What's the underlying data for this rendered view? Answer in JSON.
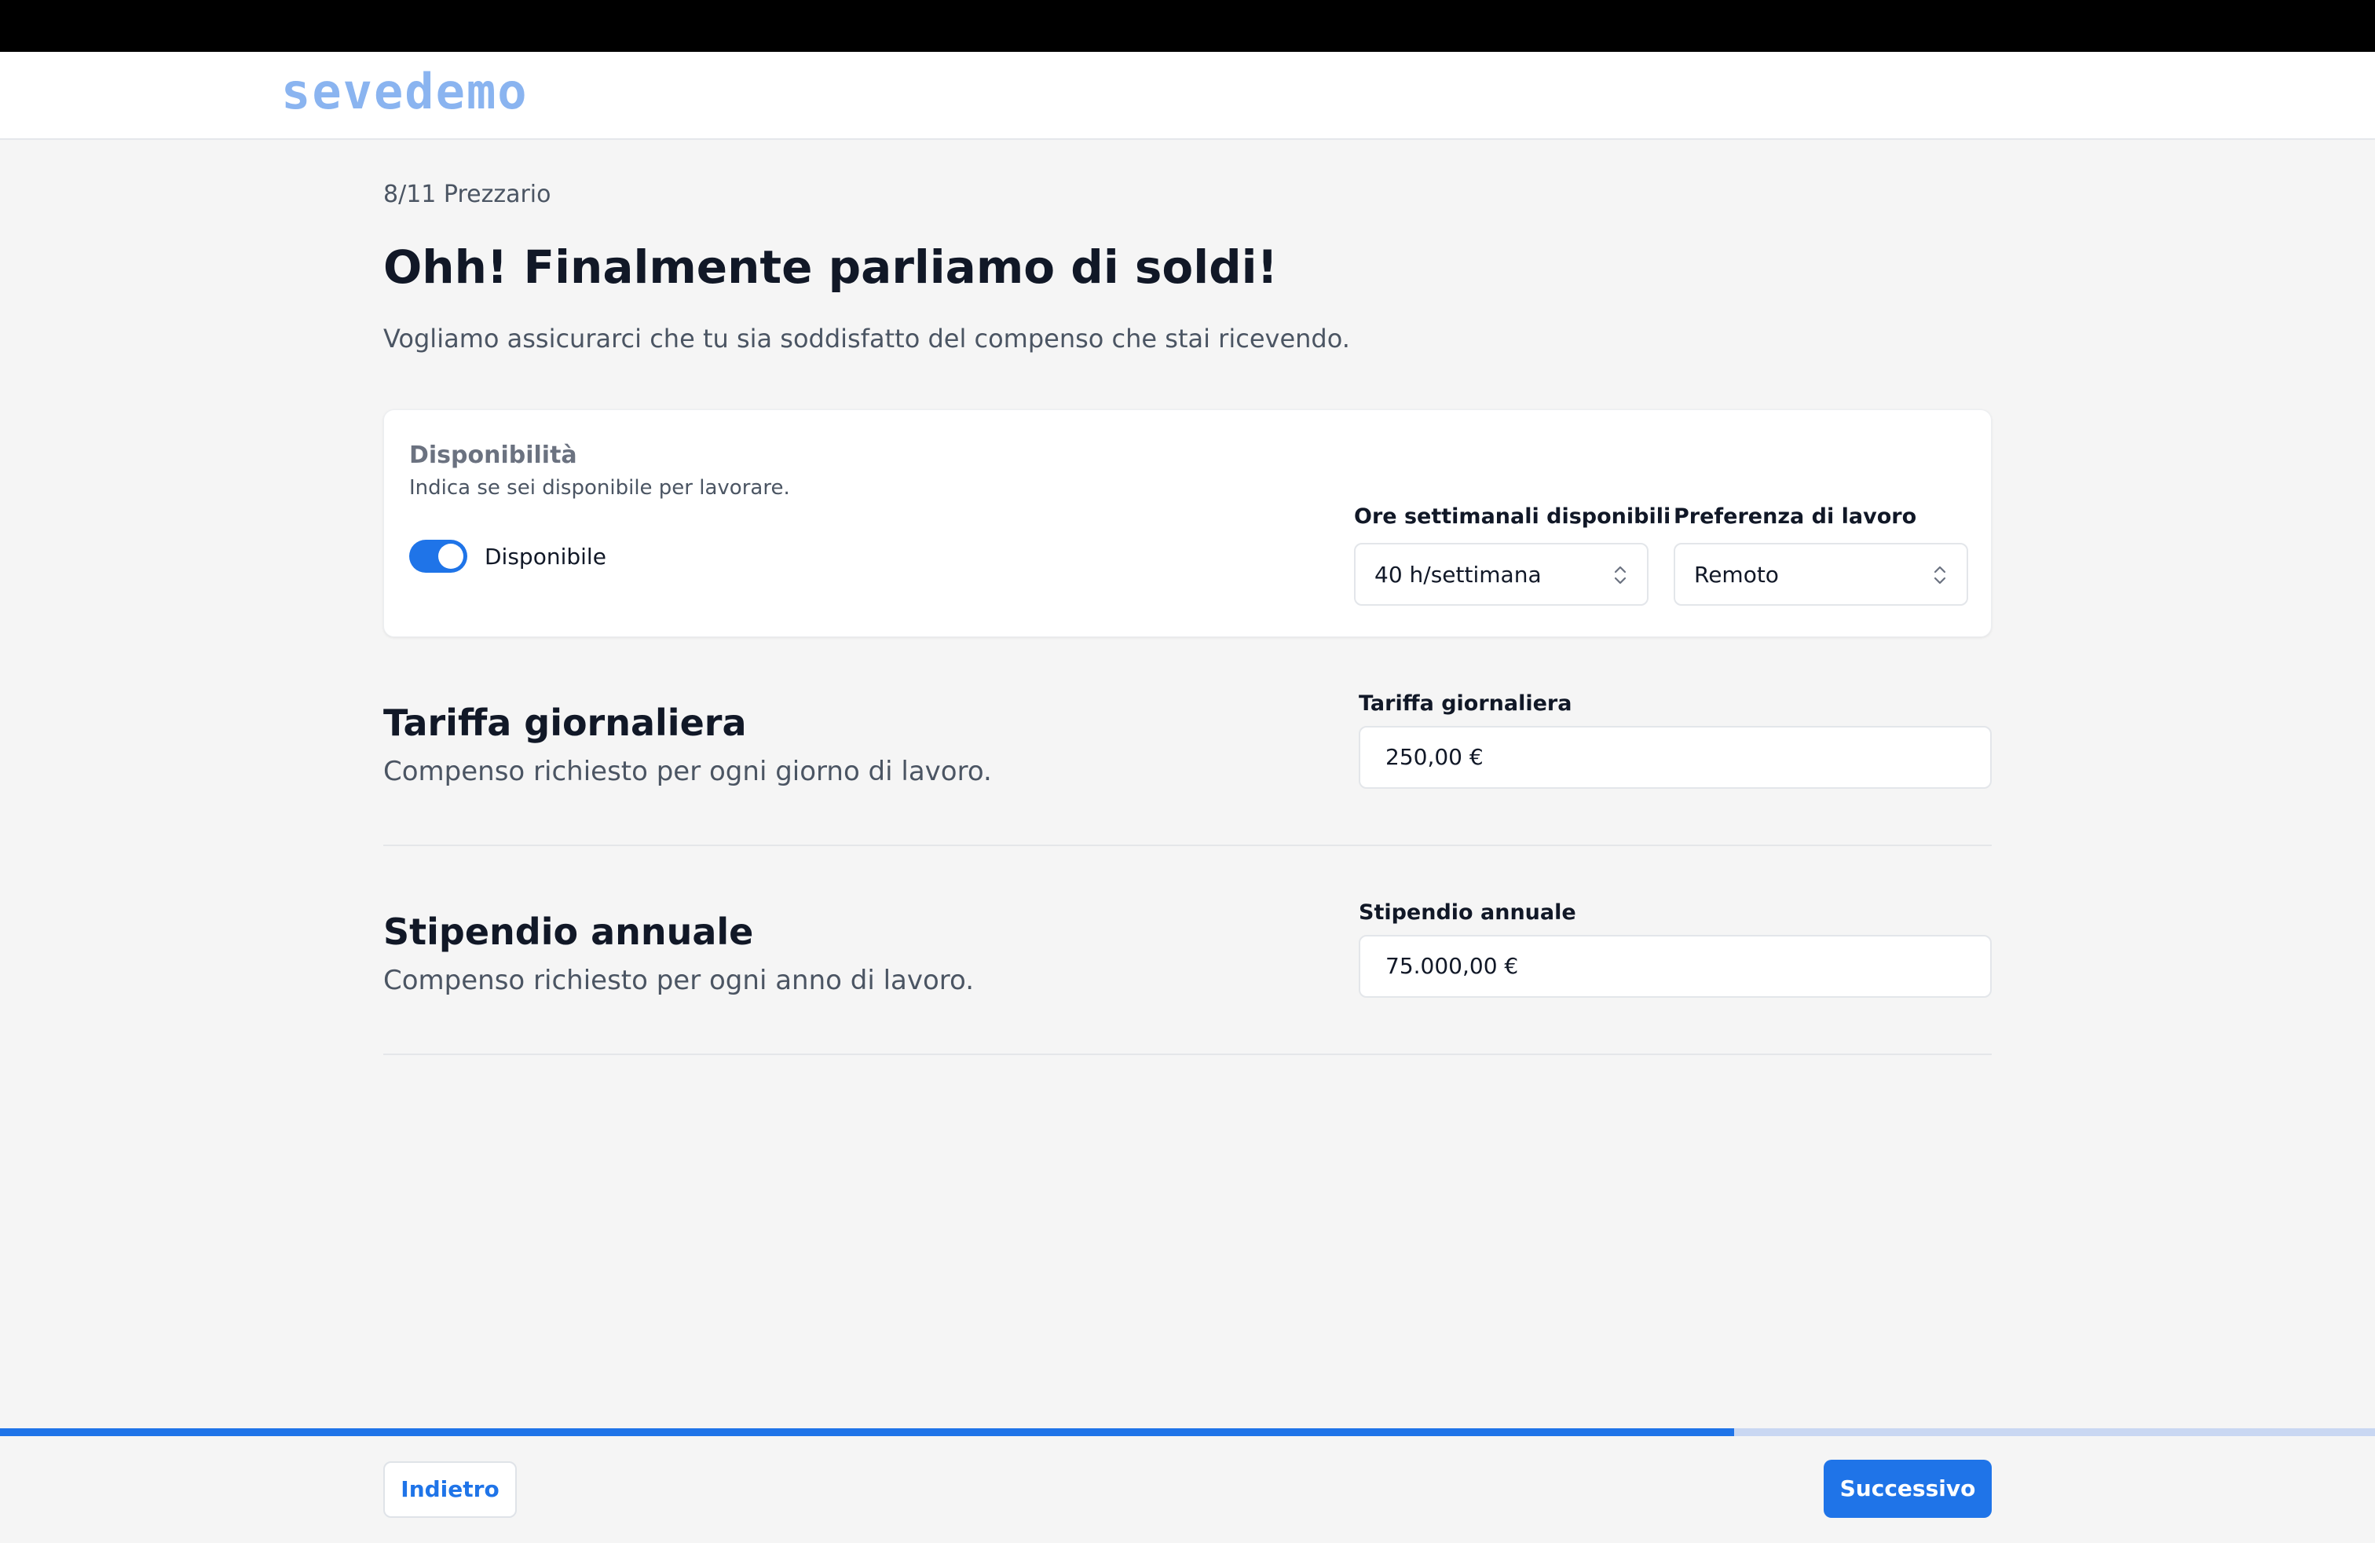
{
  "brand": {
    "logo_text": "sevedemo"
  },
  "step": {
    "label": "8/11 Prezzario"
  },
  "page": {
    "title": "Ohh! Finalmente parliamo di soldi!",
    "subtitle": "Vogliamo assicurarci che tu sia soddisfatto del compenso che stai ricevendo."
  },
  "availability": {
    "title": "Disponibilità",
    "description": "Indica se sei disponibile per lavorare.",
    "toggle_label": "Disponibile",
    "toggle_on": true,
    "hours": {
      "label": "Ore settimanali disponibili",
      "value": "40 h/settimana"
    },
    "preference": {
      "label": "Preferenza di lavoro",
      "value": "Remoto"
    }
  },
  "daily_rate": {
    "title": "Tariffa giornaliera",
    "description": "Compenso richiesto per ogni giorno di lavoro.",
    "field_label": "Tariffa giornaliera",
    "value": "250,00 €"
  },
  "annual_salary": {
    "title": "Stipendio annuale",
    "description": "Compenso richiesto per ogni anno di lavoro.",
    "field_label": "Stipendio annuale",
    "value": "75.000,00 €"
  },
  "progress": {
    "fraction": 0.7302
  },
  "footer": {
    "back_label": "Indietro",
    "next_label": "Successivo"
  },
  "colors": {
    "accent": "#1f74e8",
    "logo": "#8ab4f0",
    "progress_track": "#c9d7f2"
  }
}
